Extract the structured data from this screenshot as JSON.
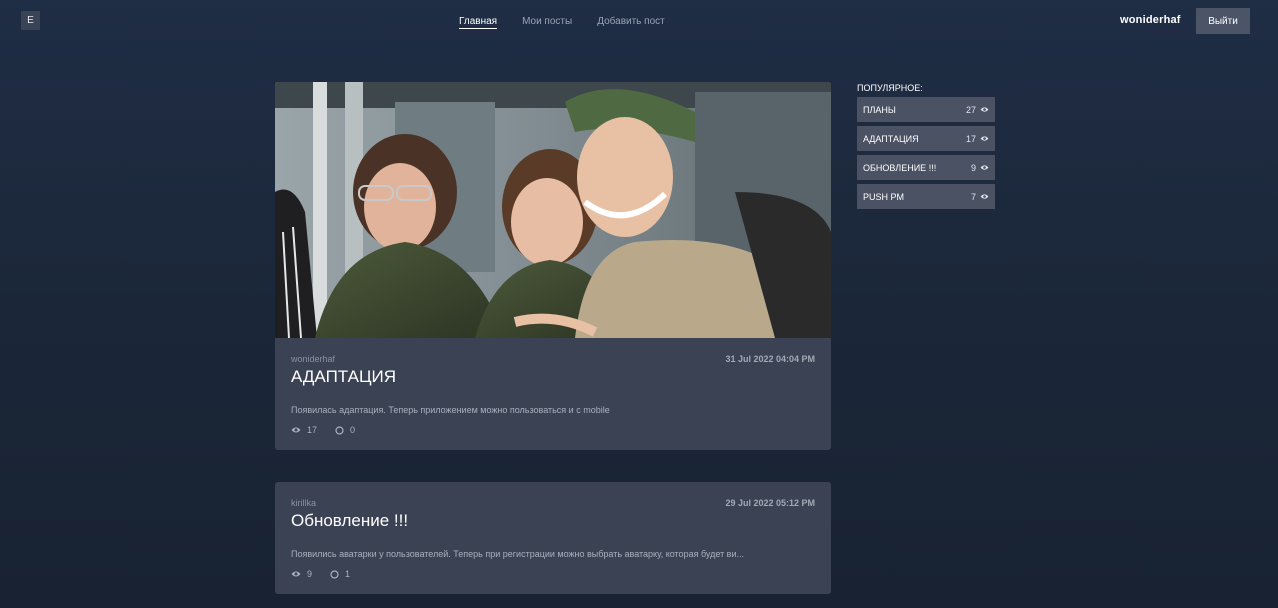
{
  "header": {
    "logo_letter": "E",
    "nav": [
      {
        "label": "Главная",
        "active": true
      },
      {
        "label": "Мои посты",
        "active": false
      },
      {
        "label": "Добавить пост",
        "active": false
      }
    ],
    "username": "woniderhaf",
    "logout_label": "Выйти"
  },
  "posts": [
    {
      "author": "woniderhaf",
      "date": "31 Jul 2022 04:04 PM",
      "title": "АДАПТАЦИЯ",
      "excerpt": "Появилась адаптация. Теперь приложением можно пользоваться и с mobile",
      "views": "17",
      "comments": "0",
      "has_image": true
    },
    {
      "author": "kirillka",
      "date": "29 Jul 2022 05:12 PM",
      "title": "Обновление !!!",
      "excerpt": "Появились аватарки у пользователей. Теперь при регистрации можно выбрать аватарку, которая будет ви...",
      "views": "9",
      "comments": "1",
      "has_image": false
    }
  ],
  "popular": {
    "title": "ПОПУЛЯРНОЕ:",
    "items": [
      {
        "label": "ПЛАНЫ",
        "count": "27"
      },
      {
        "label": "АДАПТАЦИЯ",
        "count": "17"
      },
      {
        "label": "ОБНОВЛЕНИЕ !!!",
        "count": "9"
      },
      {
        "label": "PUSH PM",
        "count": "7"
      }
    ]
  },
  "colors": {
    "background": "#1c283b",
    "card": "#3a4254",
    "popular_item": "#4a5264",
    "logout_button": "#4b5567"
  }
}
